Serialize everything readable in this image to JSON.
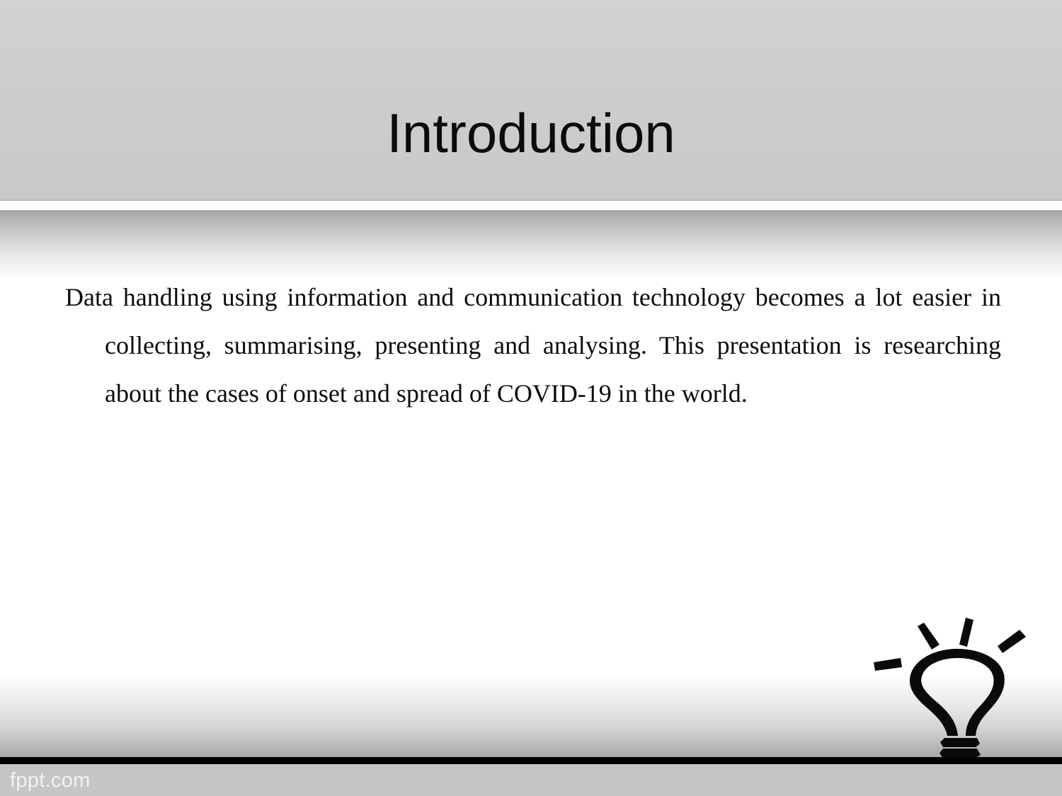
{
  "slide": {
    "title": "Introduction",
    "background_color": "#ffffff",
    "header_color": "#cdcdcd",
    "text_color": "#0d0d0d"
  },
  "header": {
    "title": "Introduction"
  },
  "body": {
    "paragraph": "Data handling using information and communication technology becomes a lot easier in collecting, summarising, presenting and analysing. This presentation is researching about the cases of onset and spread of COVID-19 in the world.",
    "lines": [
      "Data handling using information and communication technology becomes a lot easier",
      "in collecting, summarising, presenting and analysing. This presentation is",
      "researching about the cases of onset and spread of COVID-19 in the world."
    ]
  },
  "footer": {
    "brand": "fppt.com",
    "rule_color": "#000000",
    "band_color": "#c5c5c5",
    "brand_color": "#f2f2f2"
  },
  "decoration": {
    "icon": "lightbulb-icon",
    "color": "#0a0a0a"
  }
}
